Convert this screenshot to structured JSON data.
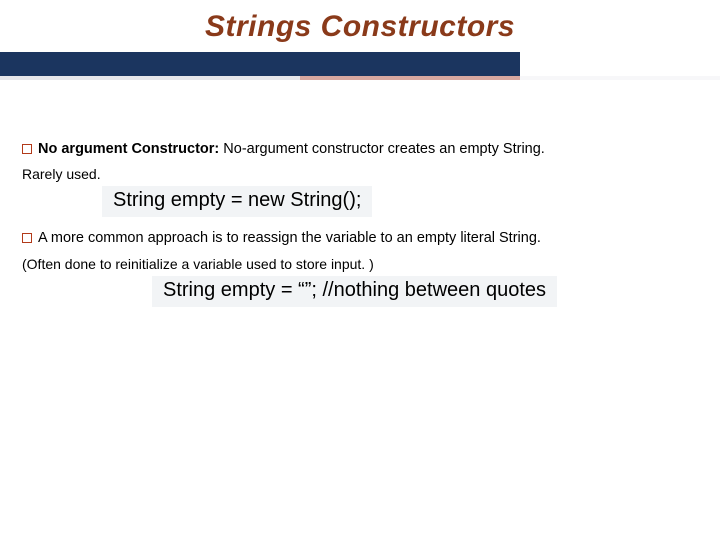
{
  "title": "Strings Constructors",
  "bullet1": {
    "label": "No argument Constructor:",
    "text": " No-argument constructor creates an empty String."
  },
  "note1": "Rarely used.",
  "code1": "String empty = new String();",
  "bullet2": {
    "text": "A more common approach is to reassign the variable to an empty literal String."
  },
  "note2": "(Often done to reinitialize a variable used to store input. )",
  "code2": "String empty = “”; //nothing between quotes"
}
